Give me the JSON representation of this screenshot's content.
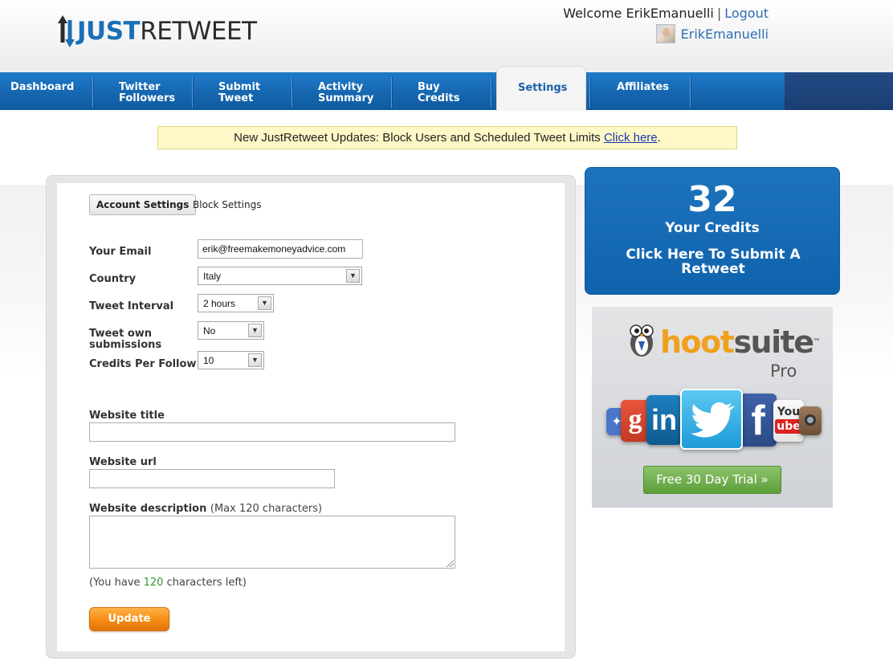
{
  "header": {
    "logo_just": "JUST",
    "logo_retweet": "RETWEET",
    "welcome_text": "Welcome ErikEmanuelli",
    "logout_label": "Logout",
    "username": "ErikEmanuelli"
  },
  "nav": {
    "items": [
      {
        "line1": "Dashboard",
        "line2": ""
      },
      {
        "line1": "Twitter",
        "line2": "Followers"
      },
      {
        "line1": "Submit",
        "line2": "Tweet"
      },
      {
        "line1": "Activity",
        "line2": "Summary"
      },
      {
        "line1": "Buy",
        "line2": "Credits"
      },
      {
        "line1": "Settings",
        "line2": ""
      },
      {
        "line1": "Affiliates",
        "line2": ""
      }
    ],
    "active": "Settings"
  },
  "notice": {
    "text": "New JustRetweet Updates: Block Users and Scheduled Tweet Limits ",
    "link": "Click here",
    "suffix": "."
  },
  "settings": {
    "tab_account": "Account Settings",
    "tab_block": "Block Settings",
    "email_label": "Your Email",
    "email_value": "erik@freemakemoneyadvice.com",
    "country_label": "Country",
    "country_value": "Italy",
    "interval_label": "Tweet Interval",
    "interval_value": "2 hours",
    "own_label_1": "Tweet own",
    "own_label_2": "submissions",
    "own_value": "No",
    "cpf_label": "Credits Per Follow",
    "cpf_value": "10",
    "site_title_label": "Website title",
    "site_title_value": "",
    "site_url_label": "Website url",
    "site_url_value": "",
    "site_desc_label": "Website description",
    "site_desc_hint": "(Max 120 characters)",
    "chars_prefix": "(You have ",
    "chars_left": "120",
    "chars_suffix": " characters left)",
    "update_label": "Update"
  },
  "credits": {
    "count": "32",
    "label": "Your Credits",
    "cta": "Click Here To Submit A Retweet"
  },
  "ad": {
    "brand_hoot": "hoot",
    "brand_suite": "suite",
    "tm": "™",
    "tier": "Pro",
    "cta": "Free 30 Day Trial »"
  },
  "colors": {
    "nav_blue": "#1667b0",
    "accent_orange": "#f58b12",
    "notice_bg": "#fdf8c6",
    "credits_blue": "#1a6db8",
    "link_blue": "#2d6fb5"
  }
}
